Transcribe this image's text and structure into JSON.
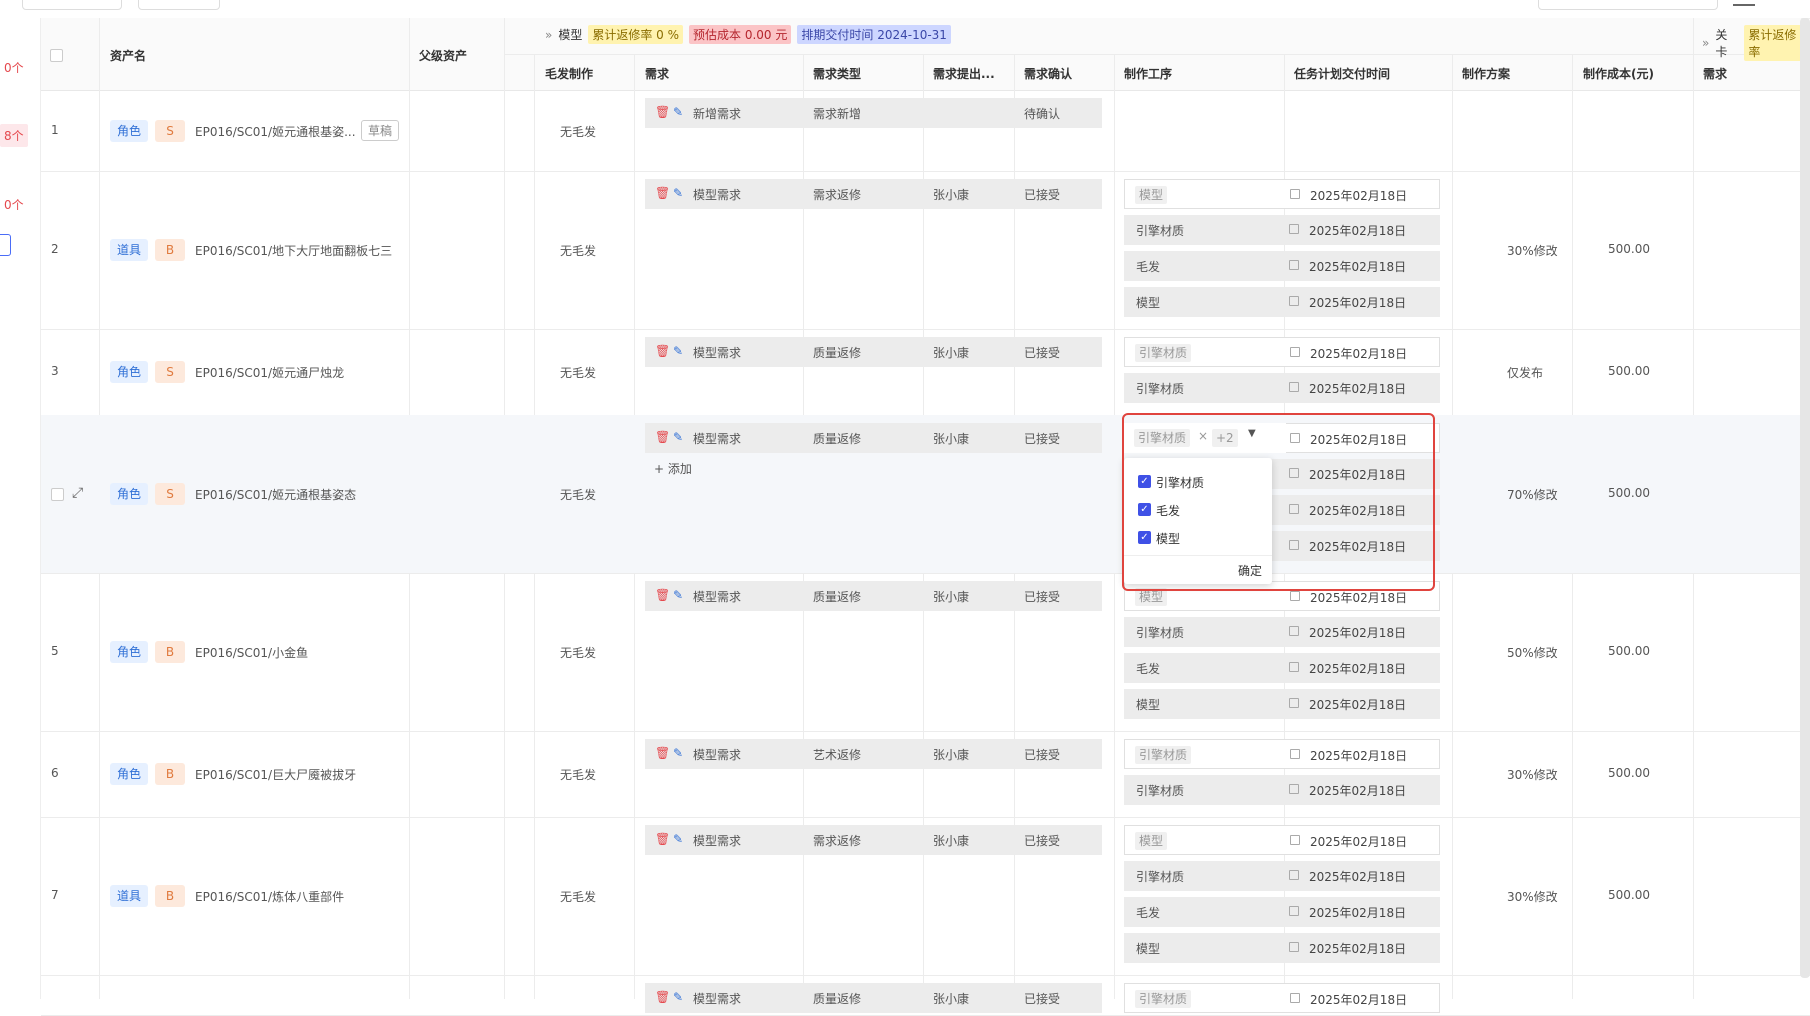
{
  "left_counts": [
    "0个",
    "8个",
    "0个"
  ],
  "header": {
    "asset_name": "资产名",
    "parent_asset": "父级资产",
    "group_model": {
      "title": "模型",
      "tag_rate": "累计返修率 0 %",
      "tag_cost": "预估成本 0.00 元",
      "tag_delivery": "排期交付时间 2024-10-31"
    },
    "group_level": {
      "title": "关卡",
      "tag_rate": "累计返修率"
    },
    "columns": [
      "毛发制作",
      "需求",
      "需求类型",
      "需求提出...",
      "需求确认",
      "制作工序",
      "任务计划交付时间",
      "制作方案",
      "制作成本(元)",
      "需求"
    ]
  },
  "rows": [
    {
      "index": "1",
      "category": "角色",
      "level": "S",
      "asset": "EP016/SC01/姬元通根基姿...",
      "draft": "草稿",
      "hair": "无毛发",
      "req": {
        "name": "新增需求",
        "type": "需求新增",
        "proposer": "",
        "status": "待确认"
      },
      "procs": [],
      "plan": "",
      "cost": ""
    },
    {
      "index": "2",
      "category": "道具",
      "level": "B",
      "asset": "EP016/SC01/地下大厅地面翻板七三",
      "hair": "无毛发",
      "req": {
        "name": "模型需求",
        "type": "需求返修",
        "proposer": "张小康",
        "status": "已接受"
      },
      "procs": [
        {
          "name": "模型",
          "date": "2025年02月18日"
        },
        {
          "name": "引擎材质",
          "date": "2025年02月18日"
        },
        {
          "name": "毛发",
          "date": "2025年02月18日"
        },
        {
          "name": "模型",
          "date": "2025年02月18日"
        }
      ],
      "plan": "30%修改",
      "cost": "500.00"
    },
    {
      "index": "3",
      "category": "角色",
      "level": "S",
      "asset": "EP016/SC01/姬元通尸烛龙",
      "hair": "无毛发",
      "req": {
        "name": "模型需求",
        "type": "质量返修",
        "proposer": "张小康",
        "status": "已接受"
      },
      "procs": [
        {
          "name": "引擎材质",
          "date": "2025年02月18日"
        },
        {
          "name": "引擎材质",
          "date": "2025年02月18日"
        }
      ],
      "plan": "仅发布",
      "cost": "500.00"
    },
    {
      "index": "",
      "category": "角色",
      "level": "S",
      "asset": "EP016/SC01/姬元通根基姿态",
      "hair": "无毛发",
      "req": {
        "name": "模型需求",
        "type": "质量返修",
        "proposer": "张小康",
        "status": "已接受"
      },
      "add_label": "添加",
      "select": {
        "chip": "引擎材质",
        "chip_close": "×",
        "more": "+2"
      },
      "procs": [
        {
          "name": "",
          "date": "2025年02月18日"
        },
        {
          "name": "",
          "date": "2025年02月18日"
        },
        {
          "name": "",
          "date": "2025年02月18日"
        },
        {
          "name": "",
          "date": "2025年02月18日"
        }
      ],
      "plan": "70%修改",
      "cost": "500.00"
    },
    {
      "index": "5",
      "category": "角色",
      "level": "B",
      "asset": "EP016/SC01/小金鱼",
      "hair": "无毛发",
      "req": {
        "name": "模型需求",
        "type": "质量返修",
        "proposer": "张小康",
        "status": "已接受"
      },
      "procs": [
        {
          "name": "模型",
          "date": "2025年02月18日"
        },
        {
          "name": "引擎材质",
          "date": "2025年02月18日"
        },
        {
          "name": "毛发",
          "date": "2025年02月18日"
        },
        {
          "name": "模型",
          "date": "2025年02月18日"
        }
      ],
      "plan": "50%修改",
      "cost": "500.00"
    },
    {
      "index": "6",
      "category": "角色",
      "level": "B",
      "asset": "EP016/SC01/巨大尸魇被拔牙",
      "hair": "无毛发",
      "req": {
        "name": "模型需求",
        "type": "艺术返修",
        "proposer": "张小康",
        "status": "已接受"
      },
      "procs": [
        {
          "name": "引擎材质",
          "date": "2025年02月18日"
        },
        {
          "name": "引擎材质",
          "date": "2025年02月18日"
        }
      ],
      "plan": "30%修改",
      "cost": "500.00"
    },
    {
      "index": "7",
      "category": "道具",
      "level": "B",
      "asset": "EP016/SC01/炼体八重部件",
      "hair": "无毛发",
      "req": {
        "name": "模型需求",
        "type": "需求返修",
        "proposer": "张小康",
        "status": "已接受"
      },
      "procs": [
        {
          "name": "模型",
          "date": "2025年02月18日"
        },
        {
          "name": "引擎材质",
          "date": "2025年02月18日"
        },
        {
          "name": "毛发",
          "date": "2025年02月18日"
        },
        {
          "name": "模型",
          "date": "2025年02月18日"
        }
      ],
      "plan": "30%修改",
      "cost": "500.00"
    },
    {
      "index": "",
      "category": "",
      "level": "",
      "asset": "",
      "hair": "",
      "req": {
        "name": "模型需求",
        "type": "质量返修",
        "proposer": "张小康",
        "status": "已接受"
      },
      "procs": [
        {
          "name": "引擎材质",
          "date": "2025年02月18日"
        }
      ],
      "plan": "",
      "cost": ""
    }
  ],
  "dropdown": {
    "options": [
      "引擎材质",
      "毛发",
      "模型"
    ],
    "confirm": "确定"
  },
  "colors": {
    "accent": "#3f51e6",
    "ok": "#2db55d",
    "danger": "#e5484d",
    "highlight_box": "#e0443e"
  }
}
